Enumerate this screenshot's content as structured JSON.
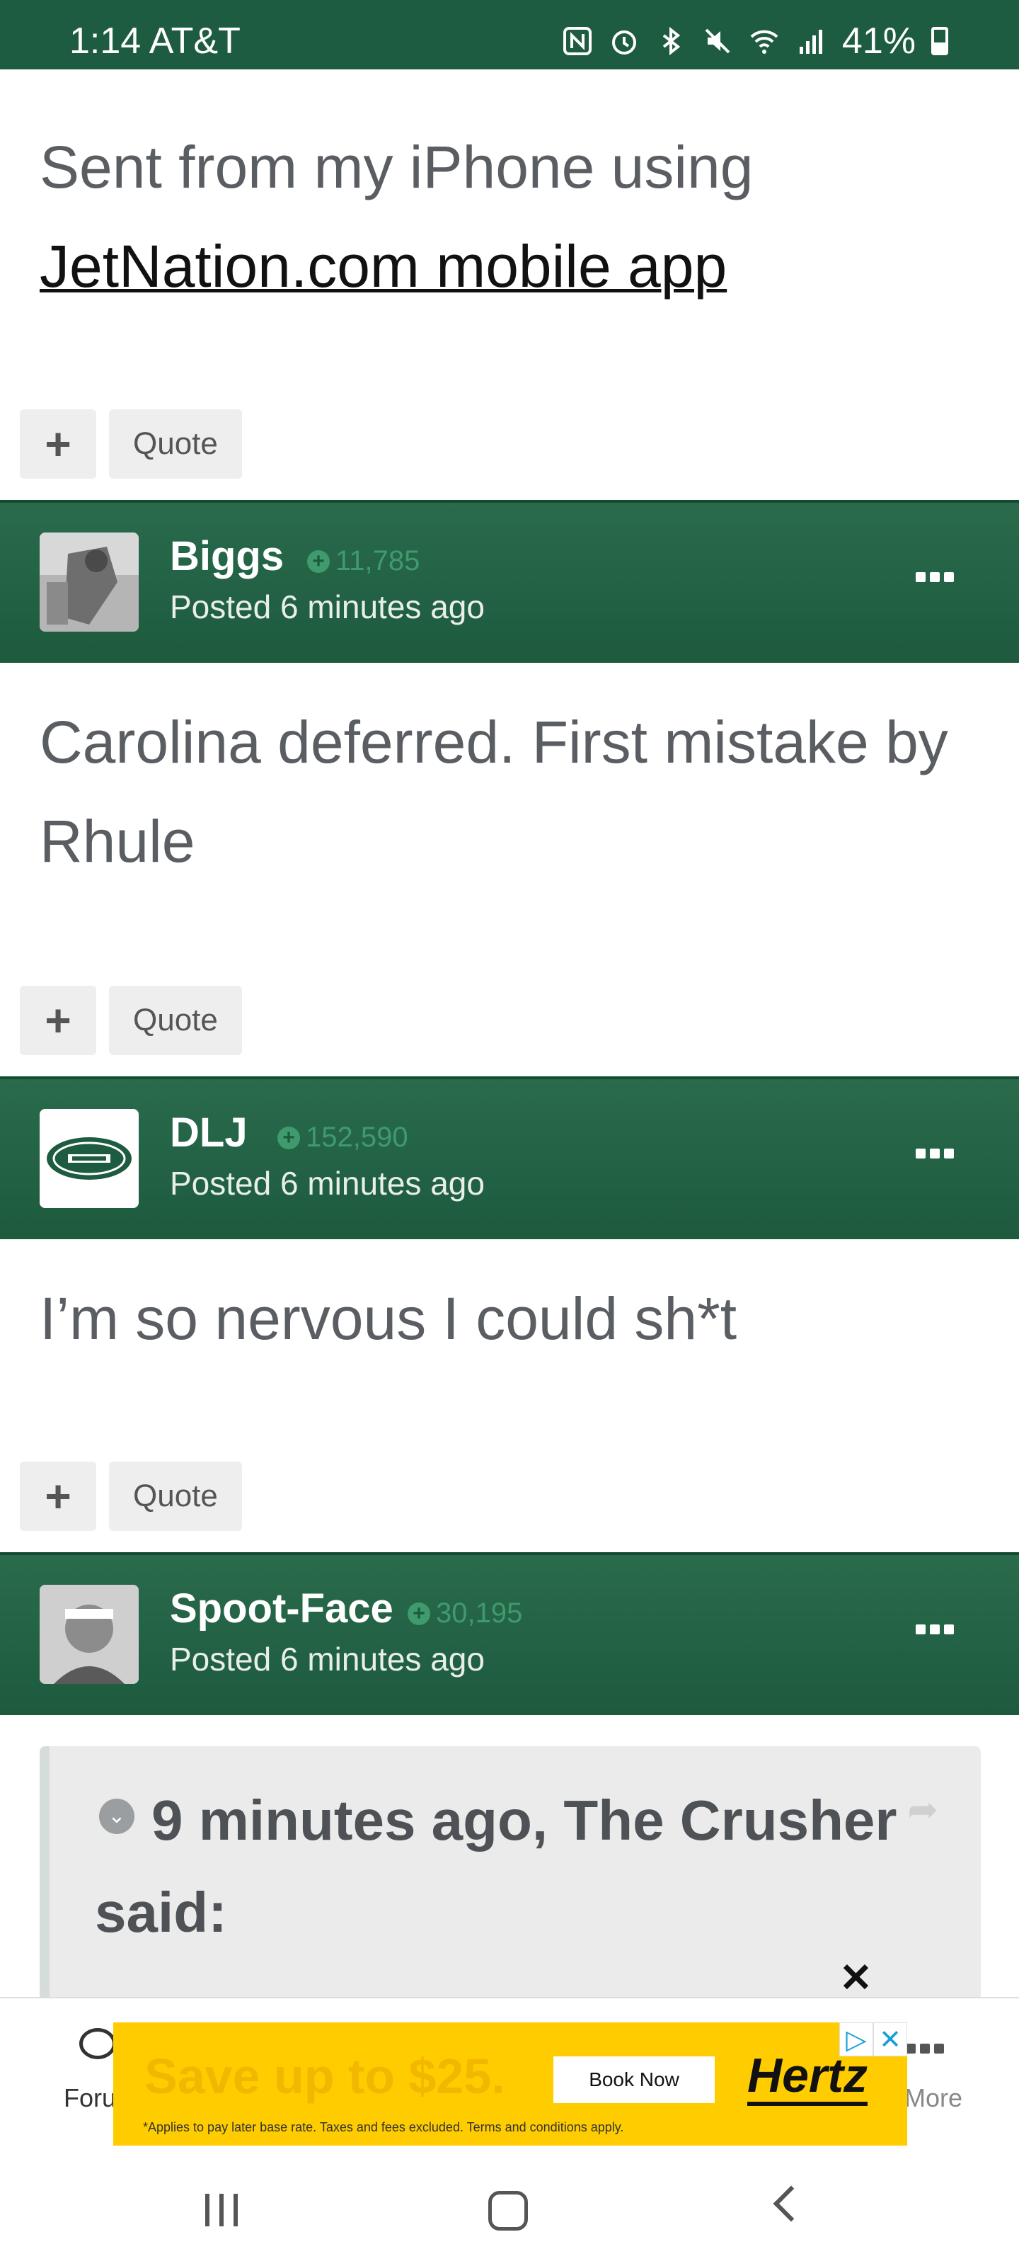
{
  "status_bar": {
    "time": "1:14",
    "carrier": "AT&T",
    "battery": "41%",
    "icons": [
      "nfc-icon",
      "alarm-icon",
      "bluetooth-icon",
      "mute-icon",
      "wifi-icon",
      "signal-icon",
      "battery-icon"
    ]
  },
  "post0": {
    "body_prefix": "Sent from my iPhone using",
    "body_link": "JetNation.com mobile app"
  },
  "actions": {
    "plus": "+",
    "quote": "Quote"
  },
  "posts": [
    {
      "author": "Biggs",
      "reputation": "11,785",
      "posted": "Posted 6 minutes ago",
      "body": "Carolina deferred.  First mistake by Rhule"
    },
    {
      "author": "DLJ",
      "reputation": "152,590",
      "posted": "Posted 6 minutes ago",
      "body": "I’m so nervous I could sh*t"
    },
    {
      "author": "Spoot-Face",
      "reputation": "30,195",
      "posted": "Posted 6 minutes ago"
    }
  ],
  "quote": {
    "header": "9 minutes ago, The Crusher said:"
  },
  "bottom_nav": {
    "forum_label": "Foru",
    "more_label": "More"
  },
  "ad": {
    "headline": "Save up to $25.",
    "cta": "Book Now",
    "brand": "Hertz",
    "disclaimer": "*Applies to pay later base rate. Taxes and fees excluded. Terms and conditions apply.",
    "close": "✕",
    "choices": "▷",
    "choices_close": "✕"
  },
  "colors": {
    "header_green": "#1e5c41",
    "reputation_green": "#3f9a6d",
    "ad_yellow": "#ffcc00"
  }
}
